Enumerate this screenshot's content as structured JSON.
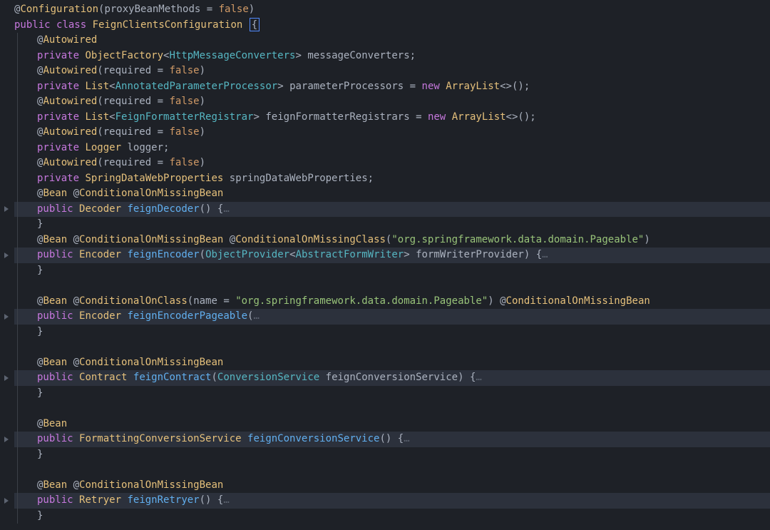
{
  "indent_unit": "    ",
  "tokens": {
    "at": "@",
    "Configuration": "Configuration",
    "lparen": "(",
    "rparen": ")",
    "proxyBeanMethods": "proxyBeanMethods",
    "eq": " = ",
    "false": "false",
    "public": "public",
    "class": "class",
    "FeignClientsConfiguration": "FeignClientsConfiguration",
    "lbrace": "{",
    "rbrace": "}",
    "Autowired": "Autowired",
    "private": "private",
    "ObjectFactory": "ObjectFactory",
    "lt": "<",
    "gt": ">",
    "HttpMessageConverters": "HttpMessageConverters",
    "messageConverters": "messageConverters",
    "semi": ";",
    "required": "required",
    "List": "List",
    "AnnotatedParameterProcessor": "AnnotatedParameterProcessor",
    "parameterProcessors": "parameterProcessors",
    "new": "new",
    "ArrayList": "ArrayList",
    "empty_generics": "<>",
    "call": "()",
    "FeignFormatterRegistrar": "FeignFormatterRegistrar",
    "feignFormatterRegistrars": "feignFormatterRegistrars",
    "Logger": "Logger",
    "logger": "logger",
    "SpringDataWebProperties": "SpringDataWebProperties",
    "springDataWebProperties": "springDataWebProperties",
    "Bean": "Bean",
    "ConditionalOnMissingBean": "ConditionalOnMissingBean",
    "ConditionalOnMissingClass": "ConditionalOnMissingClass",
    "ConditionalOnClass": "ConditionalOnClass",
    "Decoder": "Decoder",
    "feignDecoder": "feignDecoder",
    "Encoder": "Encoder",
    "feignEncoder": "feignEncoder",
    "ObjectProvider": "ObjectProvider",
    "AbstractFormWriter": "AbstractFormWriter",
    "formWriterProvider": "formWriterProvider",
    "pageable_str": "\"org.springframework.data.domain.Pageable\"",
    "name": "name",
    "feignEncoderPageable": "feignEncoderPageable",
    "Contract": "Contract",
    "feignContract": "feignContract",
    "ConversionService": "ConversionService",
    "feignConversionService_param": "feignConversionService",
    "FormattingConversionService": "FormattingConversionService",
    "feignConversionService_m": "feignConversionService",
    "Retryer": "Retryer",
    "feignRetryer": "feignRetryer",
    "ellipsis": "…",
    "sp": " "
  },
  "lines": [
    {
      "indent": 0,
      "hl": false,
      "fold": false,
      "guides": [],
      "segs": [
        [
          "c-at",
          "at"
        ],
        [
          "c-anno",
          "Configuration"
        ],
        [
          "c-punc",
          "lparen"
        ],
        [
          "c-ident",
          "proxyBeanMethods"
        ],
        [
          "c-punc",
          "eq"
        ],
        [
          "c-bool",
          "false"
        ],
        [
          "c-punc",
          "rparen"
        ]
      ]
    },
    {
      "indent": 0,
      "hl": false,
      "fold": false,
      "guides": [],
      "cursorAfter": true,
      "segs": [
        [
          "c-kw",
          "public"
        ],
        [
          "c-punc",
          "sp"
        ],
        [
          "c-kw",
          "class"
        ],
        [
          "c-punc",
          "sp"
        ],
        [
          "c-type2",
          "FeignClientsConfiguration"
        ],
        [
          "c-punc",
          "sp"
        ]
      ]
    },
    {
      "indent": 1,
      "hl": false,
      "fold": false,
      "guides": [
        0
      ],
      "segs": [
        [
          "c-at",
          "at"
        ],
        [
          "c-anno",
          "Autowired"
        ]
      ]
    },
    {
      "indent": 1,
      "hl": false,
      "fold": false,
      "guides": [
        0
      ],
      "segs": [
        [
          "c-kw",
          "private"
        ],
        [
          "c-punc",
          "sp"
        ],
        [
          "c-type2",
          "ObjectFactory"
        ],
        [
          "c-punc",
          "lt"
        ],
        [
          "c-type",
          "HttpMessageConverters"
        ],
        [
          "c-punc",
          "gt"
        ],
        [
          "c-punc",
          "sp"
        ],
        [
          "c-ident",
          "messageConverters"
        ],
        [
          "c-punc",
          "semi"
        ]
      ]
    },
    {
      "indent": 1,
      "hl": false,
      "fold": false,
      "guides": [
        0
      ],
      "segs": [
        [
          "c-at",
          "at"
        ],
        [
          "c-anno",
          "Autowired"
        ],
        [
          "c-punc",
          "lparen"
        ],
        [
          "c-ident",
          "required"
        ],
        [
          "c-punc",
          "eq"
        ],
        [
          "c-bool",
          "false"
        ],
        [
          "c-punc",
          "rparen"
        ]
      ]
    },
    {
      "indent": 1,
      "hl": false,
      "fold": false,
      "guides": [
        0
      ],
      "segs": [
        [
          "c-kw",
          "private"
        ],
        [
          "c-punc",
          "sp"
        ],
        [
          "c-type2",
          "List"
        ],
        [
          "c-punc",
          "lt"
        ],
        [
          "c-type",
          "AnnotatedParameterProcessor"
        ],
        [
          "c-punc",
          "gt"
        ],
        [
          "c-punc",
          "sp"
        ],
        [
          "c-ident",
          "parameterProcessors"
        ],
        [
          "c-punc",
          "eq"
        ],
        [
          "c-kw",
          "new"
        ],
        [
          "c-punc",
          "sp"
        ],
        [
          "c-type2",
          "ArrayList"
        ],
        [
          "c-punc",
          "empty_generics"
        ],
        [
          "c-punc",
          "call"
        ],
        [
          "c-punc",
          "semi"
        ]
      ]
    },
    {
      "indent": 1,
      "hl": false,
      "fold": false,
      "guides": [
        0
      ],
      "segs": [
        [
          "c-at",
          "at"
        ],
        [
          "c-anno",
          "Autowired"
        ],
        [
          "c-punc",
          "lparen"
        ],
        [
          "c-ident",
          "required"
        ],
        [
          "c-punc",
          "eq"
        ],
        [
          "c-bool",
          "false"
        ],
        [
          "c-punc",
          "rparen"
        ]
      ]
    },
    {
      "indent": 1,
      "hl": false,
      "fold": false,
      "guides": [
        0
      ],
      "segs": [
        [
          "c-kw",
          "private"
        ],
        [
          "c-punc",
          "sp"
        ],
        [
          "c-type2",
          "List"
        ],
        [
          "c-punc",
          "lt"
        ],
        [
          "c-type",
          "FeignFormatterRegistrar"
        ],
        [
          "c-punc",
          "gt"
        ],
        [
          "c-punc",
          "sp"
        ],
        [
          "c-ident",
          "feignFormatterRegistrars"
        ],
        [
          "c-punc",
          "eq"
        ],
        [
          "c-kw",
          "new"
        ],
        [
          "c-punc",
          "sp"
        ],
        [
          "c-type2",
          "ArrayList"
        ],
        [
          "c-punc",
          "empty_generics"
        ],
        [
          "c-punc",
          "call"
        ],
        [
          "c-punc",
          "semi"
        ]
      ]
    },
    {
      "indent": 1,
      "hl": false,
      "fold": false,
      "guides": [
        0
      ],
      "segs": [
        [
          "c-at",
          "at"
        ],
        [
          "c-anno",
          "Autowired"
        ],
        [
          "c-punc",
          "lparen"
        ],
        [
          "c-ident",
          "required"
        ],
        [
          "c-punc",
          "eq"
        ],
        [
          "c-bool",
          "false"
        ],
        [
          "c-punc",
          "rparen"
        ]
      ]
    },
    {
      "indent": 1,
      "hl": false,
      "fold": false,
      "guides": [
        0
      ],
      "segs": [
        [
          "c-kw",
          "private"
        ],
        [
          "c-punc",
          "sp"
        ],
        [
          "c-type2",
          "Logger"
        ],
        [
          "c-punc",
          "sp"
        ],
        [
          "c-ident",
          "logger"
        ],
        [
          "c-punc",
          "semi"
        ]
      ]
    },
    {
      "indent": 1,
      "hl": false,
      "fold": false,
      "guides": [
        0
      ],
      "segs": [
        [
          "c-at",
          "at"
        ],
        [
          "c-anno",
          "Autowired"
        ],
        [
          "c-punc",
          "lparen"
        ],
        [
          "c-ident",
          "required"
        ],
        [
          "c-punc",
          "eq"
        ],
        [
          "c-bool",
          "false"
        ],
        [
          "c-punc",
          "rparen"
        ]
      ]
    },
    {
      "indent": 1,
      "hl": false,
      "fold": false,
      "guides": [
        0
      ],
      "segs": [
        [
          "c-kw",
          "private"
        ],
        [
          "c-punc",
          "sp"
        ],
        [
          "c-type2",
          "SpringDataWebProperties"
        ],
        [
          "c-punc",
          "sp"
        ],
        [
          "c-ident",
          "springDataWebProperties"
        ],
        [
          "c-punc",
          "semi"
        ]
      ]
    },
    {
      "indent": 1,
      "hl": false,
      "fold": false,
      "guides": [
        0
      ],
      "segs": [
        [
          "c-at",
          "at"
        ],
        [
          "c-anno",
          "Bean"
        ],
        [
          "c-punc",
          "sp"
        ],
        [
          "c-at",
          "at"
        ],
        [
          "c-anno",
          "ConditionalOnMissingBean"
        ]
      ]
    },
    {
      "indent": 1,
      "hl": true,
      "fold": true,
      "guides": [
        0
      ],
      "segs": [
        [
          "c-kw",
          "public"
        ],
        [
          "c-punc",
          "sp"
        ],
        [
          "c-type2",
          "Decoder"
        ],
        [
          "c-punc",
          "sp"
        ],
        [
          "c-method",
          "feignDecoder"
        ],
        [
          "c-punc",
          "call"
        ],
        [
          "c-punc",
          "sp"
        ],
        [
          "c-punc",
          "lbrace"
        ],
        [
          "c-ellip",
          "ellipsis"
        ]
      ]
    },
    {
      "indent": 1,
      "hl": false,
      "fold": false,
      "guides": [
        0
      ],
      "segs": [
        [
          "c-punc",
          "rbrace"
        ]
      ]
    },
    {
      "indent": 1,
      "hl": false,
      "fold": false,
      "guides": [
        0
      ],
      "segs": [
        [
          "c-at",
          "at"
        ],
        [
          "c-anno",
          "Bean"
        ],
        [
          "c-punc",
          "sp"
        ],
        [
          "c-at",
          "at"
        ],
        [
          "c-anno",
          "ConditionalOnMissingBean"
        ],
        [
          "c-punc",
          "sp"
        ],
        [
          "c-at",
          "at"
        ],
        [
          "c-anno",
          "ConditionalOnMissingClass"
        ],
        [
          "c-punc",
          "lparen"
        ],
        [
          "c-str",
          "pageable_str"
        ],
        [
          "c-punc",
          "rparen"
        ]
      ]
    },
    {
      "indent": 1,
      "hl": true,
      "fold": true,
      "guides": [
        0
      ],
      "segs": [
        [
          "c-kw",
          "public"
        ],
        [
          "c-punc",
          "sp"
        ],
        [
          "c-type2",
          "Encoder"
        ],
        [
          "c-punc",
          "sp"
        ],
        [
          "c-method",
          "feignEncoder"
        ],
        [
          "c-punc",
          "lparen"
        ],
        [
          "c-type",
          "ObjectProvider"
        ],
        [
          "c-punc",
          "lt"
        ],
        [
          "c-type",
          "AbstractFormWriter"
        ],
        [
          "c-punc",
          "gt"
        ],
        [
          "c-punc",
          "sp"
        ],
        [
          "c-ident",
          "formWriterProvider"
        ],
        [
          "c-punc",
          "rparen"
        ],
        [
          "c-punc",
          "sp"
        ],
        [
          "c-punc",
          "lbrace"
        ],
        [
          "c-ellip",
          "ellipsis"
        ]
      ]
    },
    {
      "indent": 1,
      "hl": false,
      "fold": false,
      "guides": [
        0
      ],
      "segs": [
        [
          "c-punc",
          "rbrace"
        ]
      ]
    },
    {
      "indent": 1,
      "hl": false,
      "fold": false,
      "guides": [
        0
      ],
      "segs": []
    },
    {
      "indent": 1,
      "hl": false,
      "fold": false,
      "guides": [
        0
      ],
      "segs": [
        [
          "c-at",
          "at"
        ],
        [
          "c-anno",
          "Bean"
        ],
        [
          "c-punc",
          "sp"
        ],
        [
          "c-at",
          "at"
        ],
        [
          "c-anno",
          "ConditionalOnClass"
        ],
        [
          "c-punc",
          "lparen"
        ],
        [
          "c-ident",
          "name"
        ],
        [
          "c-punc",
          "eq"
        ],
        [
          "c-str",
          "pageable_str"
        ],
        [
          "c-punc",
          "rparen"
        ],
        [
          "c-punc",
          "sp"
        ],
        [
          "c-at",
          "at"
        ],
        [
          "c-anno",
          "ConditionalOnMissingBean"
        ]
      ]
    },
    {
      "indent": 1,
      "hl": true,
      "fold": true,
      "guides": [
        0
      ],
      "segs": [
        [
          "c-kw",
          "public"
        ],
        [
          "c-punc",
          "sp"
        ],
        [
          "c-type2",
          "Encoder"
        ],
        [
          "c-punc",
          "sp"
        ],
        [
          "c-method",
          "feignEncoderPageable"
        ],
        [
          "c-punc",
          "lparen"
        ],
        [
          "c-ellip",
          "ellipsis"
        ]
      ]
    },
    {
      "indent": 1,
      "hl": false,
      "fold": false,
      "guides": [
        0
      ],
      "segs": [
        [
          "c-punc",
          "rbrace"
        ]
      ]
    },
    {
      "indent": 1,
      "hl": false,
      "fold": false,
      "guides": [
        0
      ],
      "segs": []
    },
    {
      "indent": 1,
      "hl": false,
      "fold": false,
      "guides": [
        0
      ],
      "segs": [
        [
          "c-at",
          "at"
        ],
        [
          "c-anno",
          "Bean"
        ],
        [
          "c-punc",
          "sp"
        ],
        [
          "c-at",
          "at"
        ],
        [
          "c-anno",
          "ConditionalOnMissingBean"
        ]
      ]
    },
    {
      "indent": 1,
      "hl": true,
      "fold": true,
      "guides": [
        0
      ],
      "segs": [
        [
          "c-kw",
          "public"
        ],
        [
          "c-punc",
          "sp"
        ],
        [
          "c-type2",
          "Contract"
        ],
        [
          "c-punc",
          "sp"
        ],
        [
          "c-method",
          "feignContract"
        ],
        [
          "c-punc",
          "lparen"
        ],
        [
          "c-type",
          "ConversionService"
        ],
        [
          "c-punc",
          "sp"
        ],
        [
          "c-ident",
          "feignConversionService_param"
        ],
        [
          "c-punc",
          "rparen"
        ],
        [
          "c-punc",
          "sp"
        ],
        [
          "c-punc",
          "lbrace"
        ],
        [
          "c-ellip",
          "ellipsis"
        ]
      ]
    },
    {
      "indent": 1,
      "hl": false,
      "fold": false,
      "guides": [
        0
      ],
      "segs": [
        [
          "c-punc",
          "rbrace"
        ]
      ]
    },
    {
      "indent": 1,
      "hl": false,
      "fold": false,
      "guides": [
        0
      ],
      "segs": []
    },
    {
      "indent": 1,
      "hl": false,
      "fold": false,
      "guides": [
        0
      ],
      "segs": [
        [
          "c-at",
          "at"
        ],
        [
          "c-anno",
          "Bean"
        ]
      ]
    },
    {
      "indent": 1,
      "hl": true,
      "fold": true,
      "guides": [
        0
      ],
      "segs": [
        [
          "c-kw",
          "public"
        ],
        [
          "c-punc",
          "sp"
        ],
        [
          "c-type2",
          "FormattingConversionService"
        ],
        [
          "c-punc",
          "sp"
        ],
        [
          "c-method",
          "feignConversionService_m"
        ],
        [
          "c-punc",
          "call"
        ],
        [
          "c-punc",
          "sp"
        ],
        [
          "c-punc",
          "lbrace"
        ],
        [
          "c-ellip",
          "ellipsis"
        ]
      ]
    },
    {
      "indent": 1,
      "hl": false,
      "fold": false,
      "guides": [
        0
      ],
      "segs": [
        [
          "c-punc",
          "rbrace"
        ]
      ]
    },
    {
      "indent": 1,
      "hl": false,
      "fold": false,
      "guides": [
        0
      ],
      "segs": []
    },
    {
      "indent": 1,
      "hl": false,
      "fold": false,
      "guides": [
        0
      ],
      "segs": [
        [
          "c-at",
          "at"
        ],
        [
          "c-anno",
          "Bean"
        ],
        [
          "c-punc",
          "sp"
        ],
        [
          "c-at",
          "at"
        ],
        [
          "c-anno",
          "ConditionalOnMissingBean"
        ]
      ]
    },
    {
      "indent": 1,
      "hl": true,
      "fold": true,
      "guides": [
        0
      ],
      "segs": [
        [
          "c-kw",
          "public"
        ],
        [
          "c-punc",
          "sp"
        ],
        [
          "c-type2",
          "Retryer"
        ],
        [
          "c-punc",
          "sp"
        ],
        [
          "c-method",
          "feignRetryer"
        ],
        [
          "c-punc",
          "call"
        ],
        [
          "c-punc",
          "sp"
        ],
        [
          "c-punc",
          "lbrace"
        ],
        [
          "c-ellip",
          "ellipsis"
        ]
      ]
    },
    {
      "indent": 1,
      "hl": false,
      "fold": false,
      "guides": [
        0
      ],
      "segs": [
        [
          "c-punc",
          "rbrace"
        ]
      ]
    }
  ]
}
